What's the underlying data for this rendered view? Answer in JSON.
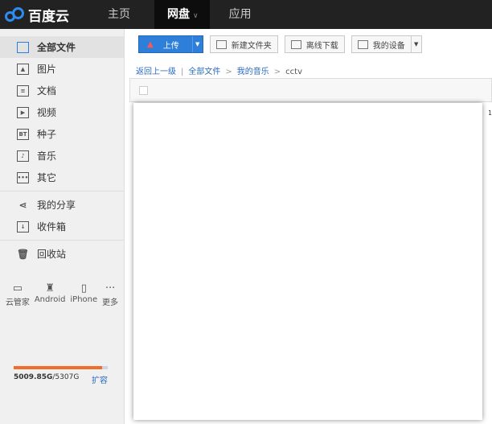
{
  "header": {
    "logo": "百度云",
    "nav": [
      {
        "label": "主页"
      },
      {
        "label": "网盘",
        "active": true
      },
      {
        "label": "应用"
      }
    ]
  },
  "sidebar": {
    "items": [
      {
        "label": "全部文件",
        "icon": "folder-icon"
      },
      {
        "label": "图片",
        "icon": "image-icon"
      },
      {
        "label": "文档",
        "icon": "document-icon"
      },
      {
        "label": "视频",
        "icon": "video-icon"
      },
      {
        "label": "种子",
        "icon": "bt-icon",
        "badge": "BT"
      },
      {
        "label": "音乐",
        "icon": "music-icon"
      },
      {
        "label": "其它",
        "icon": "more-icon"
      }
    ],
    "items2": [
      {
        "label": "我的分享"
      },
      {
        "label": "收件箱"
      }
    ],
    "recycle": "回收站",
    "devices": [
      {
        "label": "云管家"
      },
      {
        "label": "Android"
      },
      {
        "label": "iPhone"
      },
      {
        "label": "更多"
      }
    ],
    "quota": {
      "used": "5009.85G",
      "total": "/5307G",
      "fraction": 0.944,
      "expand": "扩容"
    }
  },
  "toolbar": {
    "upload": "上传",
    "new_folder": "新建文件夹",
    "offline": "离线下载",
    "devices": "我的设备"
  },
  "breadcrumb": {
    "back": "返回上一级",
    "sep": "|",
    "items": [
      "全部文件",
      "我的音乐"
    ],
    "arrow": ">",
    "current": "cctv"
  },
  "side_number": "1",
  "colors": {
    "accent": "#2e7fd9",
    "quota": "#f26c2a"
  }
}
